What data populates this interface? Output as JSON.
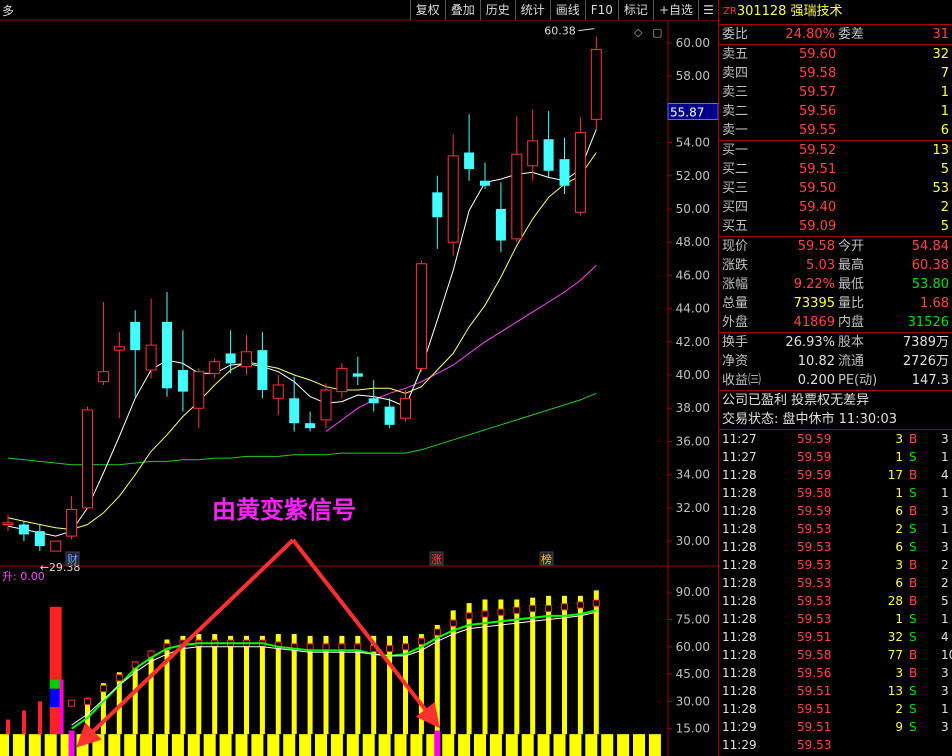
{
  "toolbar": {
    "edge_label": "多",
    "buttons": [
      "复权",
      "叠加",
      "历史",
      "统计",
      "画线",
      "F10",
      "标记",
      "+自选"
    ],
    "menu_icon": "grid-menu-icon"
  },
  "chart": {
    "price_ticks": [
      "60.00",
      "58.00",
      "56.00",
      "54.00",
      "52.00",
      "50.00",
      "48.00",
      "46.00",
      "44.00",
      "42.00",
      "40.00",
      "38.00",
      "36.00",
      "34.00",
      "32.00",
      "30.00"
    ],
    "current_price_tag": "55.87",
    "high_label": "60.38",
    "low_label": "29.38",
    "bottom_markers": [
      {
        "text": "财",
        "color": "#66aaff"
      },
      {
        "text": "涨",
        "color": "#ff4444"
      },
      {
        "text": "榜",
        "color": "#ffcc00"
      }
    ],
    "annotation": "由黄变紫信号",
    "annotation_color": "#ff22ff",
    "ind_label": "升: 0.00",
    "ind_ticks": [
      "90.00",
      "75.00",
      "60.00",
      "45.00",
      "30.00",
      "15.00"
    ],
    "colors": {
      "up": "#ff3333",
      "down": "#44ffff",
      "ma5": "#ffffff",
      "ma10": "#ffff66",
      "ma20": "#ff44ff",
      "ma60": "#22cc22",
      "axis": "#a00000",
      "arrow": "#ff3030"
    }
  },
  "chart_data": {
    "type": "candlestick",
    "price_ylim": [
      28.5,
      61.5
    ],
    "candles": [
      {
        "o": 31.0,
        "h": 31.6,
        "c": 31.1,
        "l": 30.6
      },
      {
        "o": 31.0,
        "h": 31.2,
        "c": 30.4,
        "l": 30.0
      },
      {
        "o": 30.6,
        "h": 31.0,
        "c": 29.7,
        "l": 29.4
      },
      {
        "o": 29.4,
        "h": 29.8,
        "c": 30.0,
        "l": 29.4
      },
      {
        "o": 30.3,
        "h": 32.7,
        "c": 31.9,
        "l": 30.1
      },
      {
        "o": 32.0,
        "h": 38.1,
        "c": 37.9,
        "l": 31.9
      },
      {
        "o": 39.6,
        "h": 44.4,
        "c": 40.2,
        "l": 39.4
      },
      {
        "o": 41.5,
        "h": 42.6,
        "c": 41.7,
        "l": 37.4
      },
      {
        "o": 43.2,
        "h": 43.9,
        "c": 41.5,
        "l": 38.7
      },
      {
        "o": 40.3,
        "h": 44.6,
        "c": 41.8,
        "l": 39.8
      },
      {
        "o": 43.2,
        "h": 45.0,
        "c": 39.2,
        "l": 38.7
      },
      {
        "o": 40.3,
        "h": 42.7,
        "c": 39.0,
        "l": 37.8
      },
      {
        "o": 38.0,
        "h": 40.4,
        "c": 40.2,
        "l": 36.8
      },
      {
        "o": 40.1,
        "h": 41.0,
        "c": 40.8,
        "l": 39.8
      },
      {
        "o": 41.3,
        "h": 42.7,
        "c": 40.7,
        "l": 40.1
      },
      {
        "o": 40.5,
        "h": 42.4,
        "c": 41.4,
        "l": 40.0
      },
      {
        "o": 41.5,
        "h": 42.6,
        "c": 39.1,
        "l": 38.6
      },
      {
        "o": 38.6,
        "h": 40.0,
        "c": 39.4,
        "l": 37.6
      },
      {
        "o": 38.6,
        "h": 39.9,
        "c": 37.1,
        "l": 36.6
      },
      {
        "o": 37.1,
        "h": 37.8,
        "c": 36.8,
        "l": 36.6
      },
      {
        "o": 37.3,
        "h": 39.5,
        "c": 39.1,
        "l": 36.8
      },
      {
        "o": 39.0,
        "h": 40.7,
        "c": 40.4,
        "l": 38.6
      },
      {
        "o": 40.1,
        "h": 41.1,
        "c": 39.9,
        "l": 39.4
      },
      {
        "o": 38.6,
        "h": 39.7,
        "c": 38.3,
        "l": 37.8
      },
      {
        "o": 38.1,
        "h": 38.6,
        "c": 37.0,
        "l": 36.8
      },
      {
        "o": 37.4,
        "h": 39.1,
        "c": 38.6,
        "l": 37.2
      },
      {
        "o": 40.4,
        "h": 46.9,
        "c": 46.7,
        "l": 40.2
      },
      {
        "o": 51.0,
        "h": 52.0,
        "c": 49.5,
        "l": 47.6
      },
      {
        "o": 48.0,
        "h": 54.5,
        "c": 53.2,
        "l": 47.2
      },
      {
        "o": 53.4,
        "h": 55.7,
        "c": 52.4,
        "l": 51.7
      },
      {
        "o": 51.7,
        "h": 52.8,
        "c": 51.4,
        "l": 51.2
      },
      {
        "o": 50.0,
        "h": 51.6,
        "c": 48.1,
        "l": 47.4
      },
      {
        "o": 48.2,
        "h": 55.6,
        "c": 53.3,
        "l": 48.0
      },
      {
        "o": 52.6,
        "h": 56.0,
        "c": 54.1,
        "l": 51.7
      },
      {
        "o": 54.2,
        "h": 55.9,
        "c": 52.3,
        "l": 51.9
      },
      {
        "o": 53.0,
        "h": 54.3,
        "c": 51.4,
        "l": 50.9
      },
      {
        "o": 49.8,
        "h": 55.5,
        "c": 54.6,
        "l": 49.6
      },
      {
        "o": 55.4,
        "h": 60.4,
        "c": 59.6,
        "l": 54.8
      }
    ],
    "ma5": [
      30.9,
      30.7,
      30.5,
      30.3,
      30.6,
      32.0,
      34.1,
      36.3,
      38.6,
      40.3,
      40.9,
      40.7,
      40.1,
      40.1,
      40.6,
      40.7,
      40.5,
      40.2,
      39.6,
      38.7,
      38.3,
      38.4,
      38.8,
      38.7,
      38.5,
      38.1,
      40.4,
      43.3,
      46.3,
      49.9,
      51.6,
      51.8,
      52.1,
      52.2,
      51.9,
      51.7,
      52.4,
      54.8
    ],
    "ma10": [
      31.4,
      31.2,
      31.0,
      30.8,
      30.7,
      31.0,
      31.7,
      32.7,
      34.0,
      35.4,
      36.4,
      37.5,
      38.4,
      39.4,
      40.3,
      40.8,
      40.6,
      40.4,
      40.0,
      39.7,
      39.3,
      39.1,
      39.1,
      39.2,
      39.2,
      38.9,
      39.3,
      40.3,
      41.3,
      42.9,
      44.2,
      45.9,
      47.8,
      49.4,
      50.7,
      51.5,
      52.0,
      53.4
    ],
    "ma20": [
      null,
      null,
      null,
      null,
      null,
      null,
      null,
      null,
      null,
      null,
      null,
      null,
      null,
      null,
      null,
      null,
      null,
      null,
      null,
      null,
      36.6,
      37.3,
      38.0,
      38.5,
      38.9,
      39.2,
      39.6,
      40.1,
      40.6,
      41.3,
      42.0,
      42.6,
      43.2,
      43.8,
      44.4,
      45.0,
      45.7,
      46.6
    ],
    "ma60": [
      35.0,
      34.9,
      34.8,
      34.7,
      34.6,
      34.6,
      34.6,
      34.6,
      34.7,
      34.8,
      34.8,
      34.9,
      34.9,
      35.0,
      35.0,
      35.1,
      35.1,
      35.1,
      35.2,
      35.2,
      35.2,
      35.3,
      35.3,
      35.3,
      35.3,
      35.3,
      35.5,
      35.8,
      36.1,
      36.4,
      36.7,
      37.0,
      37.3,
      37.6,
      37.9,
      38.2,
      38.5,
      38.9
    ],
    "ind_ylim": [
      0,
      100
    ],
    "ind_tall": [
      null,
      null,
      null,
      null,
      null,
      32,
      40,
      46,
      52,
      58,
      64,
      66,
      67,
      67,
      66,
      66,
      66,
      67,
      67,
      66,
      66,
      66,
      66,
      66,
      66,
      66,
      67,
      72,
      80,
      84,
      86,
      86,
      86,
      87,
      88,
      88,
      88,
      91
    ],
    "ind_mid": [
      null,
      null,
      null,
      null,
      29,
      30,
      37,
      43,
      50,
      56,
      60,
      62,
      62,
      62,
      62,
      62,
      62,
      61,
      60,
      60,
      60,
      60,
      60,
      59,
      59,
      60,
      63,
      68,
      73,
      77,
      78,
      79,
      80,
      81,
      81,
      82,
      83,
      84
    ],
    "ind_line1": [
      null,
      null,
      null,
      null,
      15,
      21,
      30,
      39,
      48,
      54,
      59,
      61,
      62,
      62,
      62,
      62,
      62,
      60,
      59,
      58,
      58,
      58,
      58,
      56,
      55,
      56,
      60,
      65,
      69,
      72,
      73,
      74,
      75,
      76,
      77,
      77,
      78,
      80
    ],
    "ind_line2": [
      null,
      null,
      null,
      null,
      17,
      23,
      31,
      39,
      46,
      52,
      56,
      59,
      60,
      60,
      60,
      60,
      60,
      59,
      58,
      57,
      57,
      57,
      57,
      56,
      55,
      55,
      58,
      63,
      67,
      70,
      71,
      72,
      73,
      74,
      75,
      76,
      77,
      79
    ],
    "left_bars": [
      {
        "h": 20,
        "c": "#ff2222"
      },
      {
        "h": 25,
        "c": "#ff2222"
      },
      {
        "h": 30,
        "c": "#ff2222"
      },
      {
        "h": 40,
        "c": "#ff2222"
      }
    ],
    "stack_bar": [
      {
        "v": 15,
        "c": "#ff2222"
      },
      {
        "v": 10,
        "c": "#0000ff"
      },
      {
        "v": 5,
        "c": "#00cc00"
      },
      {
        "v": 40,
        "c": "#ff2222"
      }
    ]
  },
  "panel": {
    "stock": {
      "tag": "ZR",
      "code": "301128",
      "name": "强瑞技术"
    },
    "weibi": {
      "label": "委比",
      "value": "24.80%",
      "label2": "委差",
      "value2": "31"
    },
    "asks": [
      {
        "label": "卖五",
        "price": "59.60",
        "vol": "32"
      },
      {
        "label": "卖四",
        "price": "59.58",
        "vol": "7"
      },
      {
        "label": "卖三",
        "price": "59.57",
        "vol": "1"
      },
      {
        "label": "卖二",
        "price": "59.56",
        "vol": "1"
      },
      {
        "label": "卖一",
        "price": "59.55",
        "vol": "6"
      }
    ],
    "bids": [
      {
        "label": "买一",
        "price": "59.52",
        "vol": "13"
      },
      {
        "label": "买二",
        "price": "59.51",
        "vol": "5"
      },
      {
        "label": "买三",
        "price": "59.50",
        "vol": "53"
      },
      {
        "label": "买四",
        "price": "59.40",
        "vol": "2"
      },
      {
        "label": "买五",
        "price": "59.09",
        "vol": "5"
      }
    ],
    "stats": [
      {
        "l1": "现价",
        "v1": "59.58",
        "c1": "red",
        "l2": "今开",
        "v2": "54.84",
        "c2": "red"
      },
      {
        "l1": "涨跌",
        "v1": "5.03",
        "c1": "red",
        "l2": "最高",
        "v2": "60.38",
        "c2": "red"
      },
      {
        "l1": "涨幅",
        "v1": "9.22%",
        "c1": "red",
        "l2": "最低",
        "v2": "53.80",
        "c2": "grn"
      },
      {
        "l1": "总量",
        "v1": "73395",
        "c1": "yel",
        "l2": "量比",
        "v2": "1.68",
        "c2": "red"
      },
      {
        "l1": "外盘",
        "v1": "41869",
        "c1": "red",
        "l2": "内盘",
        "v2": "31526",
        "c2": "grn"
      }
    ],
    "stats2": [
      {
        "l1": "换手",
        "v1": "26.93%",
        "l2": "股本",
        "v2": "7389万"
      },
      {
        "l1": "净资",
        "v1": "10.82",
        "l2": "流通",
        "v2": "2726万"
      },
      {
        "l1": "收益㈢",
        "v1": "0.200",
        "l2": "PE(动)",
        "v2": "147.3"
      }
    ],
    "info1": "公司已盈利 投票权无差异",
    "info2": "交易状态: 盘中休市 11:30:03",
    "trades": [
      {
        "t": "11:27",
        "p": "59.59",
        "v": "3",
        "d": "B",
        "n": "3"
      },
      {
        "t": "11:27",
        "p": "59.59",
        "v": "1",
        "d": "S",
        "n": "1"
      },
      {
        "t": "11:28",
        "p": "59.59",
        "v": "17",
        "d": "B",
        "n": "4"
      },
      {
        "t": "11:28",
        "p": "59.58",
        "v": "1",
        "d": "S",
        "n": "1"
      },
      {
        "t": "11:28",
        "p": "59.59",
        "v": "6",
        "d": "B",
        "n": "3"
      },
      {
        "t": "11:28",
        "p": "59.53",
        "v": "2",
        "d": "S",
        "n": "1"
      },
      {
        "t": "11:28",
        "p": "59.53",
        "v": "6",
        "d": "S",
        "n": "3"
      },
      {
        "t": "11:28",
        "p": "59.53",
        "v": "3",
        "d": "B",
        "n": "2"
      },
      {
        "t": "11:28",
        "p": "59.53",
        "v": "6",
        "d": "B",
        "n": "2"
      },
      {
        "t": "11:28",
        "p": "59.53",
        "v": "28",
        "d": "B",
        "n": "5"
      },
      {
        "t": "11:28",
        "p": "59.53",
        "v": "1",
        "d": "S",
        "n": "1"
      },
      {
        "t": "11:28",
        "p": "59.51",
        "v": "32",
        "d": "S",
        "n": "4"
      },
      {
        "t": "11:28",
        "p": "59.58",
        "v": "77",
        "d": "B",
        "n": "10"
      },
      {
        "t": "11:28",
        "p": "59.56",
        "v": "3",
        "d": "B",
        "n": "3"
      },
      {
        "t": "11:28",
        "p": "59.51",
        "v": "13",
        "d": "S",
        "n": "3"
      },
      {
        "t": "11:28",
        "p": "59.51",
        "v": "2",
        "d": "S",
        "n": "1"
      },
      {
        "t": "11:29",
        "p": "59.51",
        "v": "9",
        "d": "S",
        "n": "3"
      },
      {
        "t": "11:29",
        "p": "59.53",
        "v": "",
        "d": "",
        "n": ""
      }
    ]
  }
}
